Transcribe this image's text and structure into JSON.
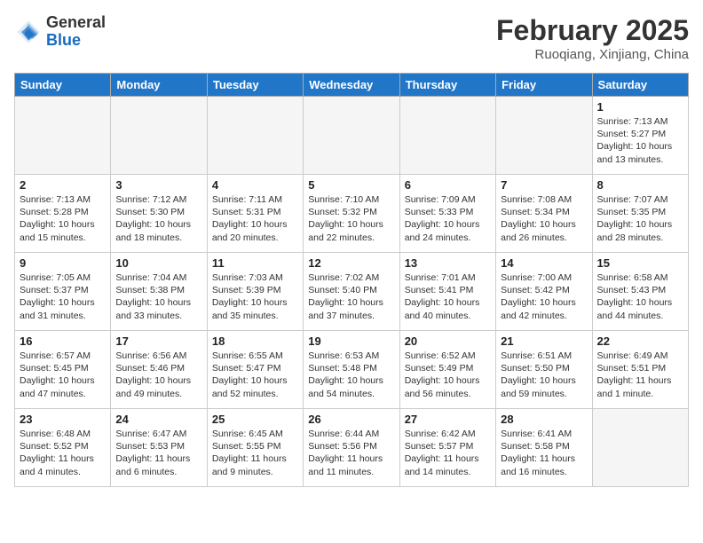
{
  "header": {
    "logo_general": "General",
    "logo_blue": "Blue",
    "month_title": "February 2025",
    "location": "Ruoqiang, Xinjiang, China"
  },
  "weekdays": [
    "Sunday",
    "Monday",
    "Tuesday",
    "Wednesday",
    "Thursday",
    "Friday",
    "Saturday"
  ],
  "weeks": [
    [
      {
        "day": "",
        "info": ""
      },
      {
        "day": "",
        "info": ""
      },
      {
        "day": "",
        "info": ""
      },
      {
        "day": "",
        "info": ""
      },
      {
        "day": "",
        "info": ""
      },
      {
        "day": "",
        "info": ""
      },
      {
        "day": "1",
        "info": "Sunrise: 7:13 AM\nSunset: 5:27 PM\nDaylight: 10 hours\nand 13 minutes."
      }
    ],
    [
      {
        "day": "2",
        "info": "Sunrise: 7:13 AM\nSunset: 5:28 PM\nDaylight: 10 hours\nand 15 minutes."
      },
      {
        "day": "3",
        "info": "Sunrise: 7:12 AM\nSunset: 5:30 PM\nDaylight: 10 hours\nand 18 minutes."
      },
      {
        "day": "4",
        "info": "Sunrise: 7:11 AM\nSunset: 5:31 PM\nDaylight: 10 hours\nand 20 minutes."
      },
      {
        "day": "5",
        "info": "Sunrise: 7:10 AM\nSunset: 5:32 PM\nDaylight: 10 hours\nand 22 minutes."
      },
      {
        "day": "6",
        "info": "Sunrise: 7:09 AM\nSunset: 5:33 PM\nDaylight: 10 hours\nand 24 minutes."
      },
      {
        "day": "7",
        "info": "Sunrise: 7:08 AM\nSunset: 5:34 PM\nDaylight: 10 hours\nand 26 minutes."
      },
      {
        "day": "8",
        "info": "Sunrise: 7:07 AM\nSunset: 5:35 PM\nDaylight: 10 hours\nand 28 minutes."
      }
    ],
    [
      {
        "day": "9",
        "info": "Sunrise: 7:05 AM\nSunset: 5:37 PM\nDaylight: 10 hours\nand 31 minutes."
      },
      {
        "day": "10",
        "info": "Sunrise: 7:04 AM\nSunset: 5:38 PM\nDaylight: 10 hours\nand 33 minutes."
      },
      {
        "day": "11",
        "info": "Sunrise: 7:03 AM\nSunset: 5:39 PM\nDaylight: 10 hours\nand 35 minutes."
      },
      {
        "day": "12",
        "info": "Sunrise: 7:02 AM\nSunset: 5:40 PM\nDaylight: 10 hours\nand 37 minutes."
      },
      {
        "day": "13",
        "info": "Sunrise: 7:01 AM\nSunset: 5:41 PM\nDaylight: 10 hours\nand 40 minutes."
      },
      {
        "day": "14",
        "info": "Sunrise: 7:00 AM\nSunset: 5:42 PM\nDaylight: 10 hours\nand 42 minutes."
      },
      {
        "day": "15",
        "info": "Sunrise: 6:58 AM\nSunset: 5:43 PM\nDaylight: 10 hours\nand 44 minutes."
      }
    ],
    [
      {
        "day": "16",
        "info": "Sunrise: 6:57 AM\nSunset: 5:45 PM\nDaylight: 10 hours\nand 47 minutes."
      },
      {
        "day": "17",
        "info": "Sunrise: 6:56 AM\nSunset: 5:46 PM\nDaylight: 10 hours\nand 49 minutes."
      },
      {
        "day": "18",
        "info": "Sunrise: 6:55 AM\nSunset: 5:47 PM\nDaylight: 10 hours\nand 52 minutes."
      },
      {
        "day": "19",
        "info": "Sunrise: 6:53 AM\nSunset: 5:48 PM\nDaylight: 10 hours\nand 54 minutes."
      },
      {
        "day": "20",
        "info": "Sunrise: 6:52 AM\nSunset: 5:49 PM\nDaylight: 10 hours\nand 56 minutes."
      },
      {
        "day": "21",
        "info": "Sunrise: 6:51 AM\nSunset: 5:50 PM\nDaylight: 10 hours\nand 59 minutes."
      },
      {
        "day": "22",
        "info": "Sunrise: 6:49 AM\nSunset: 5:51 PM\nDaylight: 11 hours\nand 1 minute."
      }
    ],
    [
      {
        "day": "23",
        "info": "Sunrise: 6:48 AM\nSunset: 5:52 PM\nDaylight: 11 hours\nand 4 minutes."
      },
      {
        "day": "24",
        "info": "Sunrise: 6:47 AM\nSunset: 5:53 PM\nDaylight: 11 hours\nand 6 minutes."
      },
      {
        "day": "25",
        "info": "Sunrise: 6:45 AM\nSunset: 5:55 PM\nDaylight: 11 hours\nand 9 minutes."
      },
      {
        "day": "26",
        "info": "Sunrise: 6:44 AM\nSunset: 5:56 PM\nDaylight: 11 hours\nand 11 minutes."
      },
      {
        "day": "27",
        "info": "Sunrise: 6:42 AM\nSunset: 5:57 PM\nDaylight: 11 hours\nand 14 minutes."
      },
      {
        "day": "28",
        "info": "Sunrise: 6:41 AM\nSunset: 5:58 PM\nDaylight: 11 hours\nand 16 minutes."
      },
      {
        "day": "",
        "info": ""
      }
    ]
  ]
}
